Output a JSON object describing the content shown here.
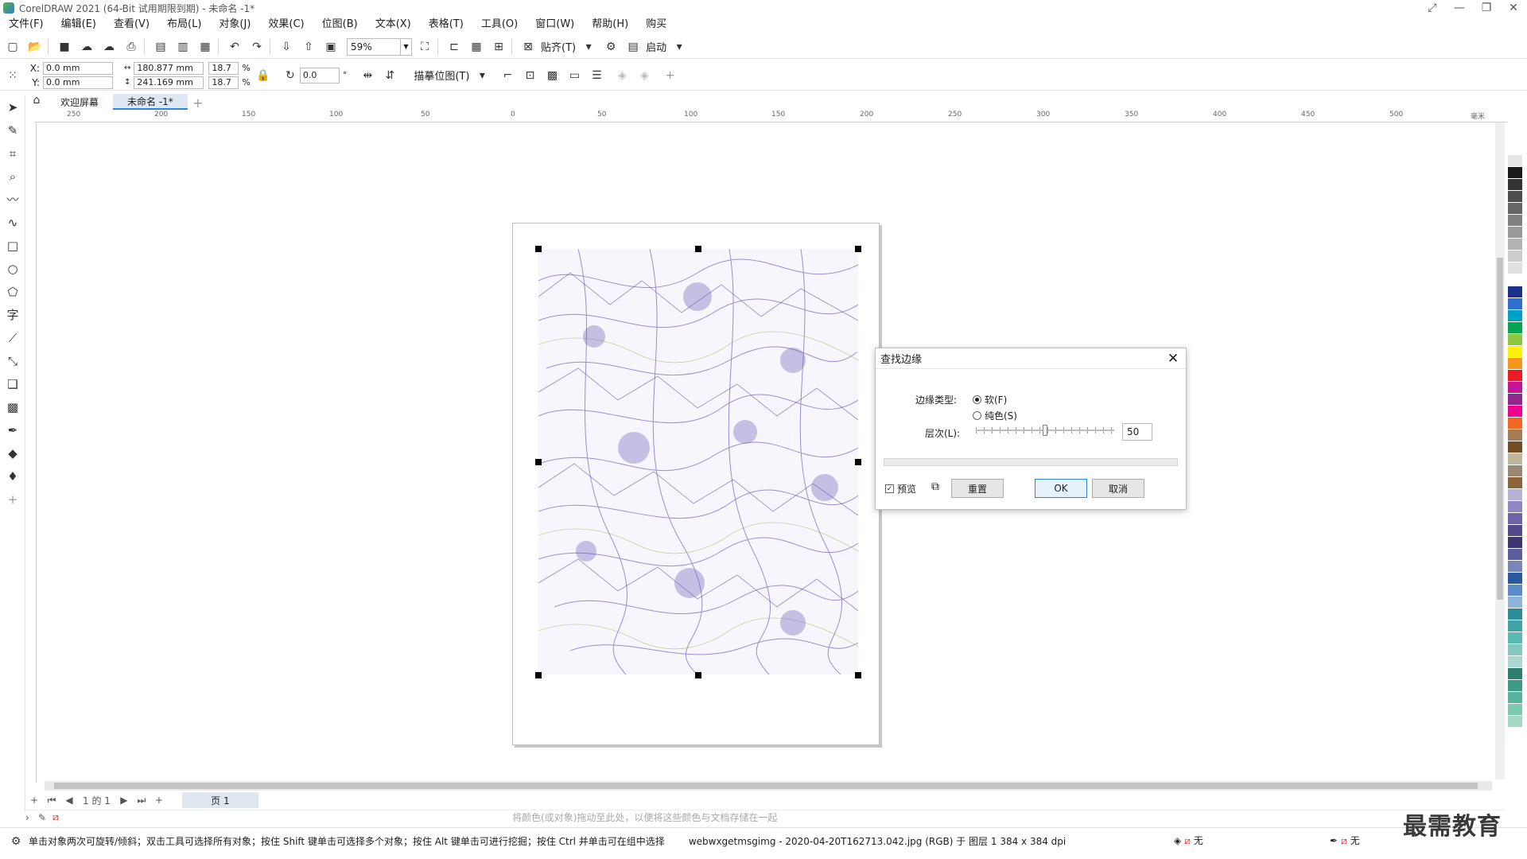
{
  "window": {
    "title": "CorelDRAW 2021 (64-Bit 试用期限到期) - 未命名 -1*"
  },
  "menu": [
    "文件(F)",
    "编辑(E)",
    "查看(V)",
    "布局(L)",
    "对象(J)",
    "效果(C)",
    "位图(B)",
    "文本(X)",
    "表格(T)",
    "工具(O)",
    "窗口(W)",
    "帮助(H)",
    "购买"
  ],
  "toolbar": {
    "zoom": "59%",
    "snap_label": "贴齐(T)",
    "launch_label": "启动"
  },
  "propbar": {
    "x": "0.0 mm",
    "y": "0.0 mm",
    "width": "180.877 mm",
    "height": "241.169 mm",
    "scale_x": "18.7",
    "scale_y": "18.7",
    "percent": "%",
    "rotation": "0.0",
    "trace_label": "描摹位图(T)",
    "x_label": "X:",
    "y_label": "Y:"
  },
  "tabs": {
    "welcome": "欢迎屏幕",
    "document": "未命名 -1*"
  },
  "ruler": {
    "h_ticks": [
      "250",
      "200",
      "150",
      "100",
      "50",
      "0",
      "50",
      "100",
      "150",
      "200",
      "250",
      "300",
      "350",
      "400",
      "450",
      "500"
    ],
    "unit": "毫米"
  },
  "pagenav": {
    "position": "1 的 1",
    "page_tab": "页 1"
  },
  "colorhint": "将颜色(或对象)拖动至此处，以便将这些颜色与文档存储在一起",
  "status": {
    "hint": "单击对象两次可旋转/倾斜；双击工具可选择所有对象；按住 Shift 键单击可选择多个对象；按住 Alt 键单击可进行挖掘；按住 Ctrl 并单击可在组中选择",
    "object_info": "webwxgetmsgimg - 2020-04-20T162713.042.jpg (RGB) 于 图层 1 384 x 384 dpi",
    "fill": "无",
    "outline": "无"
  },
  "watermark": "最需教育",
  "dialog": {
    "title": "查找边缘",
    "edge_type_label": "边缘类型:",
    "option_soft": "软(F)",
    "option_solid": "纯色(S)",
    "level_label": "层次(L):",
    "level_value": "50",
    "level": 50,
    "preview_label": "预览",
    "reset": "重置",
    "ok": "OK",
    "cancel": "取消"
  },
  "palette": [
    "#ffffff",
    "#e6e6e6",
    "#1a1a1a",
    "#333333",
    "#4d4d4d",
    "#666666",
    "#808080",
    "#999999",
    "#b3b3b3",
    "#cccccc",
    "#e0e0e0",
    "#ffffff",
    "#1b2f8c",
    "#2e6fcf",
    "#00a0c6",
    "#00a651",
    "#8dc63f",
    "#fff200",
    "#f7941d",
    "#ed1c24",
    "#c4159a",
    "#92278f",
    "#ec008c",
    "#f26522",
    "#a67c52",
    "#754c24",
    "#c2b59b",
    "#998675",
    "#8c6239",
    "#b7b1d6",
    "#8f86c2",
    "#6c63a8",
    "#524a8c",
    "#3d3570",
    "#5b5f9e",
    "#7b86b8",
    "#2c5aa0",
    "#5a8dc7",
    "#8fb3d9",
    "#2e8b9a",
    "#3fa3a8",
    "#5cb8b2",
    "#84c7c0",
    "#a8d8cf",
    "#2f7f6f",
    "#3e9a87",
    "#58b49c",
    "#7ec8b0",
    "#a3d9c3"
  ]
}
